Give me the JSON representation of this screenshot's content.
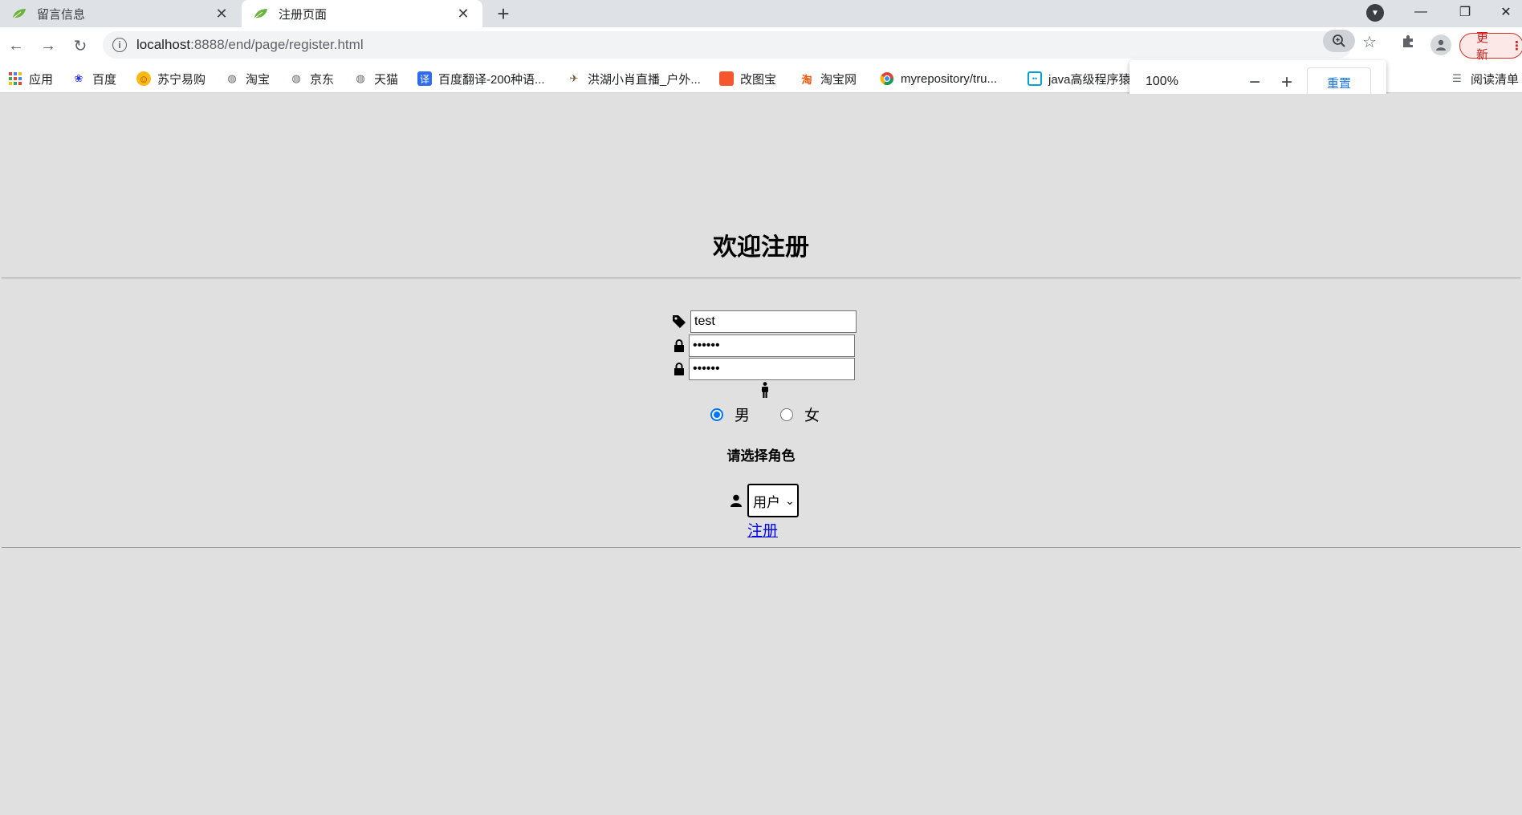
{
  "browser": {
    "tabs": [
      {
        "title": "留言信息",
        "active": false
      },
      {
        "title": "注册页面",
        "active": true
      }
    ],
    "new_tab_symbol": "+",
    "address": {
      "host": "localhost",
      "path": ":8888/end/page/register.html"
    },
    "update_label": "更新",
    "bookmarks": [
      {
        "label": "应用",
        "icon": "apps-grid-icon"
      },
      {
        "label": "百度",
        "icon": "baidu-paw-icon"
      },
      {
        "label": "苏宁易购",
        "icon": "suning-lion-icon"
      },
      {
        "label": "淘宝",
        "icon": "globe-icon"
      },
      {
        "label": "京东",
        "icon": "globe-icon"
      },
      {
        "label": "天猫",
        "icon": "globe-icon"
      },
      {
        "label": "百度翻译-200种语...",
        "icon": "translate-icon"
      },
      {
        "label": "洪湖小肖直播_户外...",
        "icon": "bird-icon"
      },
      {
        "label": "改图宝",
        "icon": "gaitubao-icon"
      },
      {
        "label": "淘宝网",
        "icon": "taobao-icon"
      },
      {
        "label": "myrepository/tru...",
        "icon": "chrome-icon"
      },
      {
        "label": "java高级程序猿",
        "icon": "bilibili-icon"
      },
      {
        "label": "阅读清单",
        "icon": "reading-list-icon"
      }
    ],
    "zoom": {
      "level": "100%",
      "reset_label": "重置"
    },
    "colors": {
      "accent": "#1a73e8",
      "update": "#d93025",
      "radio": "#0075ff",
      "link": "#0000ee"
    }
  },
  "page": {
    "title": "欢迎注册",
    "username_value": "test",
    "password_value": "••••••",
    "confirm_value": "••••••",
    "gender": {
      "male": "男",
      "female": "女",
      "selected": "男"
    },
    "role_label": "请选择角色",
    "role_selected": "用户",
    "register_label": "注册"
  }
}
